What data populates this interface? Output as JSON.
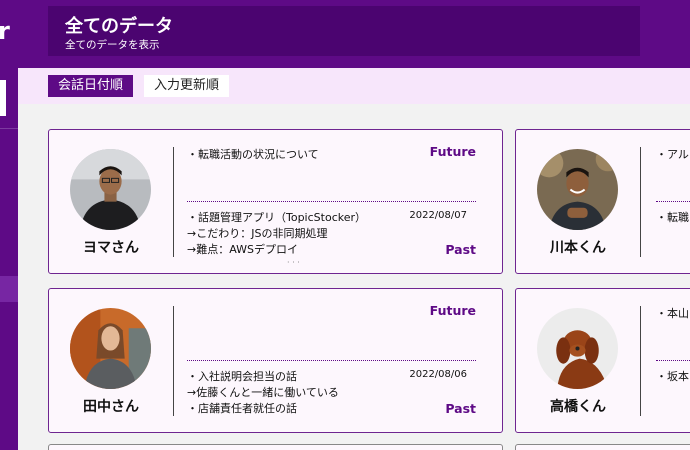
{
  "sidebar": {
    "logo_fragment": "r"
  },
  "header": {
    "title": "全てのデータ",
    "subtitle": "全てのデータを表示"
  },
  "tabs": [
    {
      "label": "会話日付順",
      "active": true
    },
    {
      "label": "入力更新順",
      "active": false
    }
  ],
  "labels": {
    "future": "Future",
    "past": "Past"
  },
  "cards": [
    {
      "name": "ヨマさん",
      "future_items": [
        "・転職活動の状況について"
      ],
      "past_date": "2022/08/07",
      "past_items": [
        "・話題管理アプリ（TopicStocker）",
        "→こだわり：JSの非同期処理",
        "→難点：AWSデプロイ"
      ],
      "more": "· · ·"
    },
    {
      "name": "川本くん",
      "future_items": [
        "・アル"
      ],
      "past_items": [
        "・転職"
      ]
    },
    {
      "name": "田中さん",
      "future_items": [],
      "past_date": "2022/08/06",
      "past_items": [
        "・入社説明会担当の話",
        "→佐藤くんと一緒に働いている",
        "・店舗責任者就任の話"
      ]
    },
    {
      "name": "高橋くん",
      "future_items": [
        "・本山"
      ],
      "past_items": [
        "・坂本"
      ]
    }
  ],
  "colors": {
    "brand": "#5e0a86",
    "header_panel": "#4b0470",
    "tabbar": "#f7e6fb",
    "card_bg": "#fdf7fd"
  },
  "icons": {
    "avatar_placeholder": "person-photo"
  }
}
